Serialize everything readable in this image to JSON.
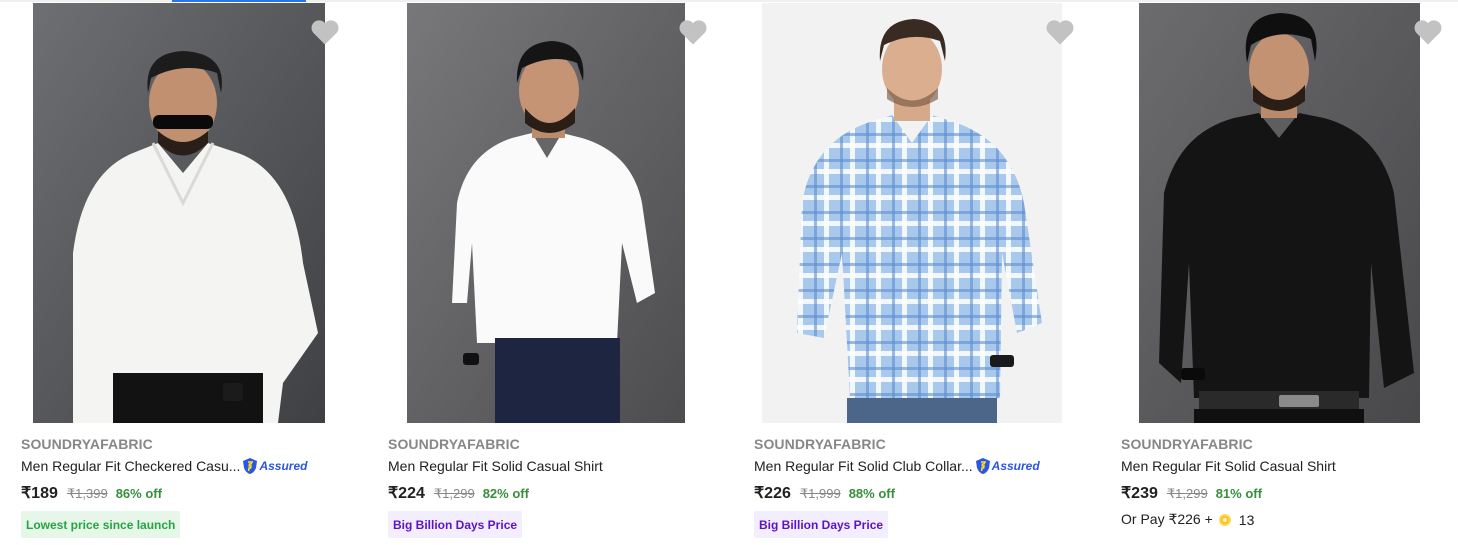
{
  "accent_color": "#2874f0",
  "assured_label": "Assured",
  "products": [
    {
      "brand": "SOUNDRYAFABRIC",
      "title": "Men Regular Fit Checkered Casu...",
      "assured": true,
      "price": "₹189",
      "mrp": "₹1,399",
      "discount": "86% off",
      "tag": "Lowest price since launch",
      "tag_style": "green",
      "shirt_color": "#f7f7f5",
      "bg_color": "#585a5d",
      "icon": "heart-icon"
    },
    {
      "brand": "SOUNDRYAFABRIC",
      "title": "Men Regular Fit Solid Casual Shirt",
      "assured": false,
      "price": "₹224",
      "mrp": "₹1,299",
      "discount": "82% off",
      "tag": "Big Billion Days Price",
      "tag_style": "purple",
      "shirt_color": "#f9f9f9",
      "bg_color": "#6b6b6e",
      "icon": "heart-icon"
    },
    {
      "brand": "SOUNDRYAFABRIC",
      "title": "Men Regular Fit Solid Club Collar...",
      "assured": true,
      "price": "₹226",
      "mrp": "₹1,999",
      "discount": "88% off",
      "tag": "Big Billion Days Price",
      "tag_style": "purple",
      "shirt_color": "#9cc1e8",
      "bg_color": "#f2f2f2",
      "icon": "heart-icon"
    },
    {
      "brand": "SOUNDRYAFABRIC",
      "title": "Men Regular Fit Solid Casual Shirt",
      "assured": false,
      "price": "₹239",
      "mrp": "₹1,299",
      "discount": "81% off",
      "pay_prefix": "Or Pay ₹226 +",
      "pay_coins": "13",
      "shirt_color": "#151515",
      "bg_color": "#5f5f62",
      "icon": "heart-icon"
    }
  ]
}
